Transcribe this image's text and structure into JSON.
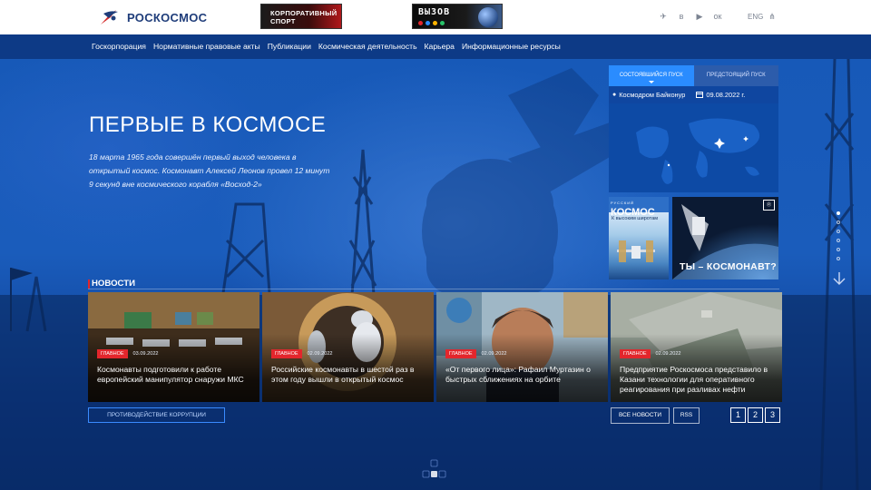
{
  "brand": {
    "name": "РОСКОСМОС"
  },
  "banners": {
    "sport": {
      "line1": "КОРПОРАТИВНЫЙ",
      "line2": "СПОРТ"
    },
    "vyzov": {
      "text": "ВЫЗОВ"
    }
  },
  "header": {
    "social": [
      {
        "icon": "telegram-icon",
        "glyph": "✈"
      },
      {
        "icon": "vk-icon",
        "glyph": "в"
      },
      {
        "icon": "youtube-icon",
        "glyph": "▶"
      },
      {
        "icon": "odnoklassniki-icon",
        "glyph": "ок"
      }
    ],
    "lang": "ENG",
    "sitemap_glyph": "⋔"
  },
  "nav": {
    "items": [
      "Госкорпорация",
      "Нормативные правовые акты",
      "Публикации",
      "Космическая деятельность",
      "Карьера",
      "Информационные ресурсы"
    ]
  },
  "hero": {
    "title": "ПЕРВЫЕ В КОСМОСЕ",
    "desc_line1": "18 марта 1965 года совершён первый выход человека в",
    "desc_line2": "открытый космос. Космонавт Алексей Леонов провел 12 минут",
    "desc_line3": "9 секунд вне космического корабля «Восход-2»"
  },
  "launch": {
    "tab_active": "СОСТОЯВШИЙСЯ ПУСК",
    "tab_inactive": "ПРЕДСТОЯЩИЙ ПУСК",
    "place": "Космодром Байконур",
    "date": "09.08.2022 г."
  },
  "magazine": {
    "kicker": "РУССКИЙ",
    "title": "КОСМОС",
    "subtitle": "К высоким широтам"
  },
  "promo": {
    "label": "ТЫ – КОСМОНАВТ?"
  },
  "news": {
    "heading": "НОВОСТИ",
    "cards": [
      {
        "tag": "ГЛАВНОЕ",
        "date": "03.09.2022",
        "title": "Космонавты подготовили к работе европейский манипулятор снаружи МКС"
      },
      {
        "tag": "ГЛАВНОЕ",
        "date": "02.09.2022",
        "title": "Российские космонавты в шестой раз в этом году вышли в открытый космос"
      },
      {
        "tag": "ГЛАВНОЕ",
        "date": "02.09.2022",
        "title": "«От первого лица»: Рафаил Муртазин о быстрых сближениях на орбите"
      },
      {
        "tag": "ГЛАВНОЕ",
        "date": "02.09.2022",
        "title": "Предприятие Роскосмоса представило в Казани технологии для оперативного реагирования при разливах нефти"
      }
    ],
    "anticorruption": "ПРОТИВОДЕЙСТВИЕ КОРРУПЦИИ",
    "all_news": "ВСЕ НОВОСТИ",
    "rss": "RSS",
    "pages": [
      "1",
      "2",
      "3"
    ]
  },
  "slider": {
    "dots": 6,
    "active": 1
  },
  "colors": {
    "accent": "#2a8cff",
    "tag": "#e3262c",
    "nav_bg": "#0d3a86",
    "logo": "#1f3d7a"
  }
}
